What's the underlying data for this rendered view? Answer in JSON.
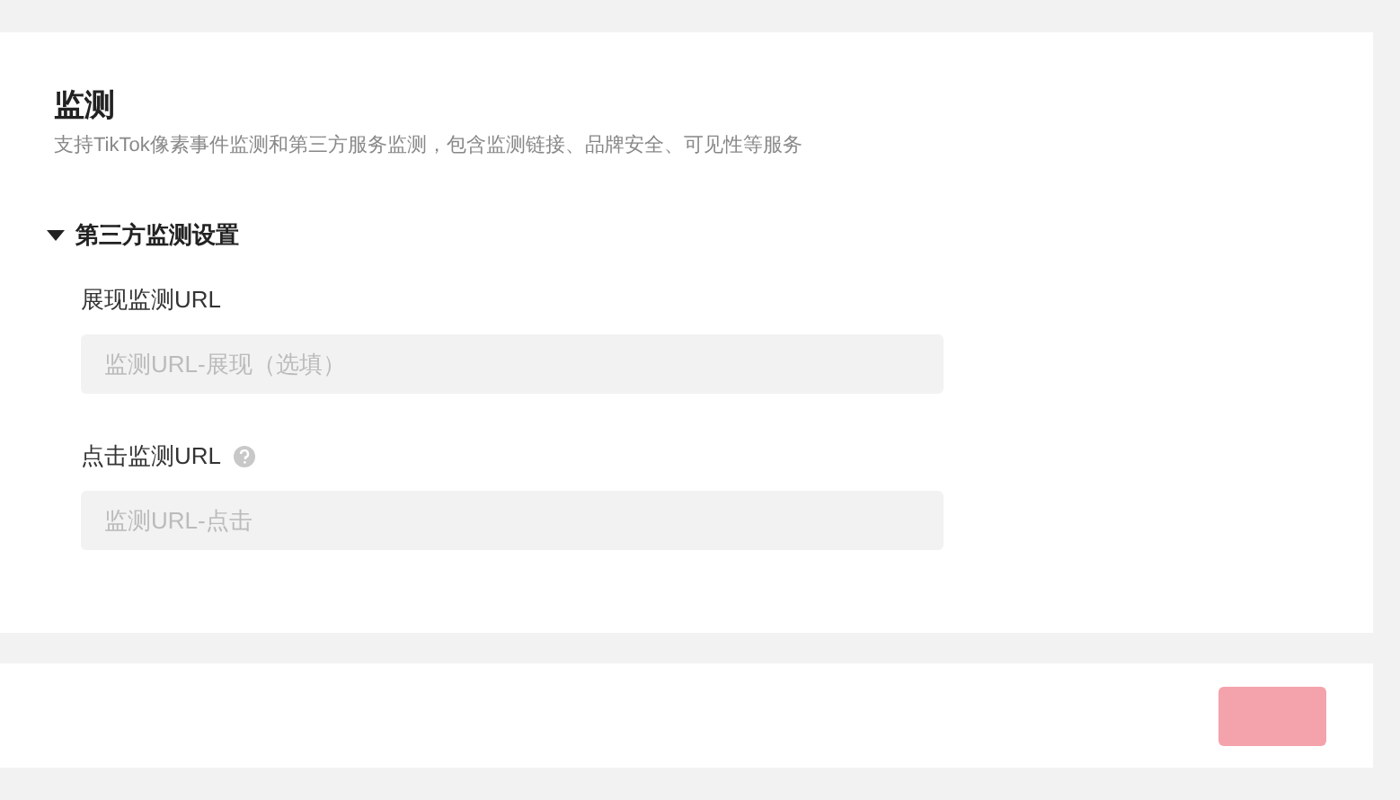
{
  "section": {
    "title": "监测",
    "description": "支持TikTok像素事件监测和第三方服务监测，包含监测链接、品牌安全、可见性等服务"
  },
  "group": {
    "title": "第三方监测设置",
    "expanded": true,
    "fields": [
      {
        "label": "展现监测URL",
        "placeholder": "监测URL-展现（选填）",
        "help": false
      },
      {
        "label": "点击监测URL",
        "placeholder": "监测URL-点击",
        "help": true
      }
    ]
  },
  "footer": {
    "button": {
      "disabled": true
    }
  }
}
